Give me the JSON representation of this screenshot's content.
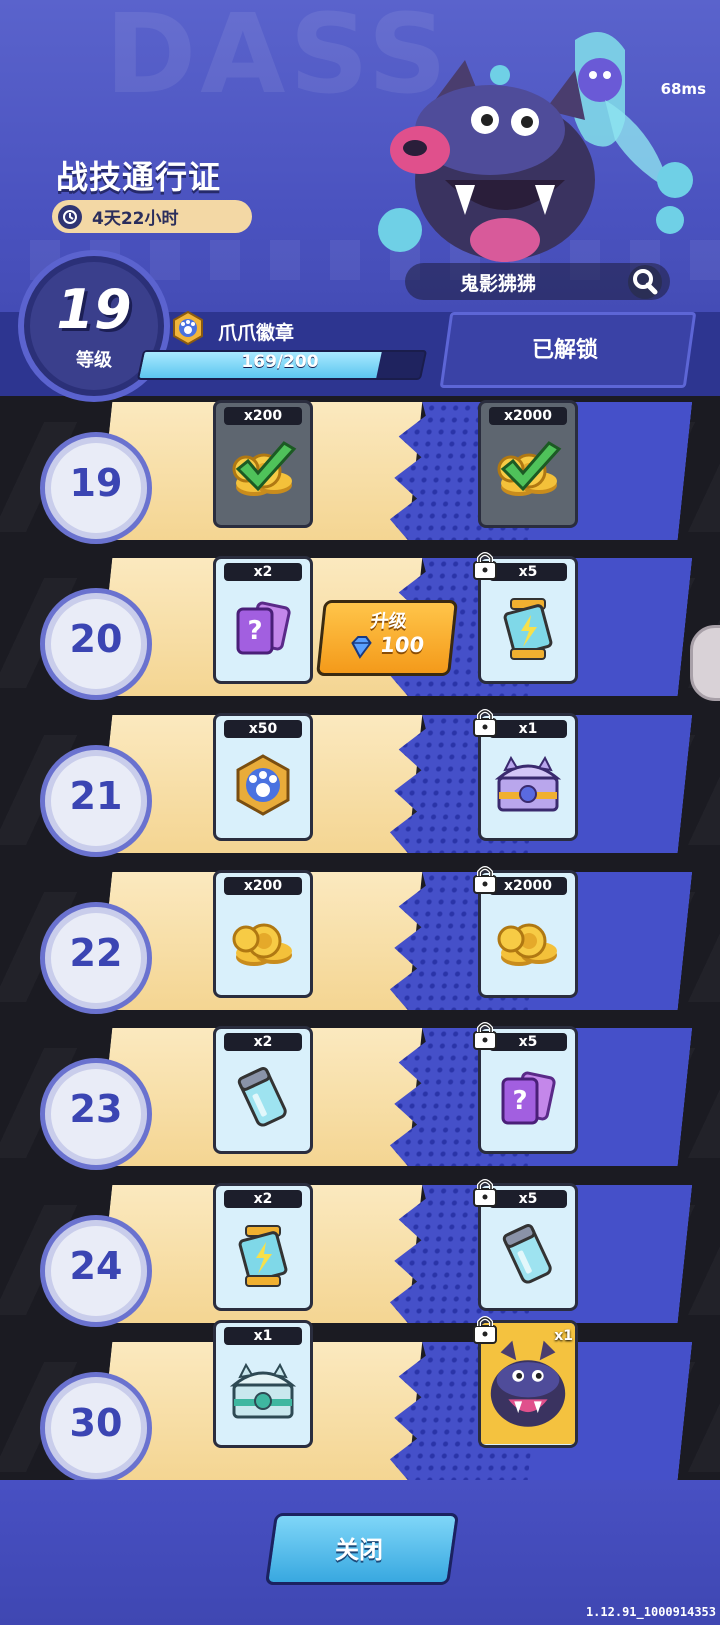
{
  "header": {
    "bg_word": "DASS",
    "ping": "68ms",
    "title": "战技通行证",
    "timer": "4天22小时",
    "hero_name": "鬼影狒狒",
    "level": "19",
    "level_label": "等级",
    "badge_name": "爪爪徽章",
    "progress_text": "169/200",
    "progress_fraction": 0.845,
    "unlocked_label": "已解锁"
  },
  "rows": [
    {
      "level": "19",
      "free": {
        "qty": "x200",
        "item": "coins",
        "claimed": true
      },
      "premium": {
        "qty": "x2000",
        "item": "coins",
        "claimed": true,
        "locked": false
      }
    },
    {
      "level": "20",
      "free": {
        "qty": "x2",
        "item": "mystery-cards"
      },
      "premium": {
        "qty": "x5",
        "item": "energy-canister",
        "locked": true
      },
      "upgrade": {
        "label": "升级",
        "cost": "100"
      }
    },
    {
      "level": "21",
      "free": {
        "qty": "x50",
        "item": "paw-badge"
      },
      "premium": {
        "qty": "x1",
        "item": "purple-chest",
        "locked": true
      }
    },
    {
      "level": "22",
      "free": {
        "qty": "x200",
        "item": "coins"
      },
      "premium": {
        "qty": "x2000",
        "item": "coins",
        "locked": true
      }
    },
    {
      "level": "23",
      "free": {
        "qty": "x2",
        "item": "battery"
      },
      "premium": {
        "qty": "x5",
        "item": "mystery-cards",
        "locked": true
      }
    },
    {
      "level": "24",
      "free": {
        "qty": "x2",
        "item": "energy-canister"
      },
      "premium": {
        "qty": "x5",
        "item": "battery",
        "locked": true
      }
    },
    {
      "level": "30",
      "free": {
        "qty": "x1",
        "item": "teal-chest"
      },
      "premium": {
        "qty": "x1",
        "item": "hero-skin",
        "locked": true
      }
    }
  ],
  "footer": {
    "close_label": "关闭",
    "version": "1.12.91_1000914353"
  },
  "colors": {
    "header_bg": "#4a52bf",
    "free_lane": "#f4d592",
    "premium_lane": "#4550c9",
    "level_text": "#3b45b3",
    "upgrade_button": "#f49a1a",
    "close_button": "#38a8e0"
  }
}
